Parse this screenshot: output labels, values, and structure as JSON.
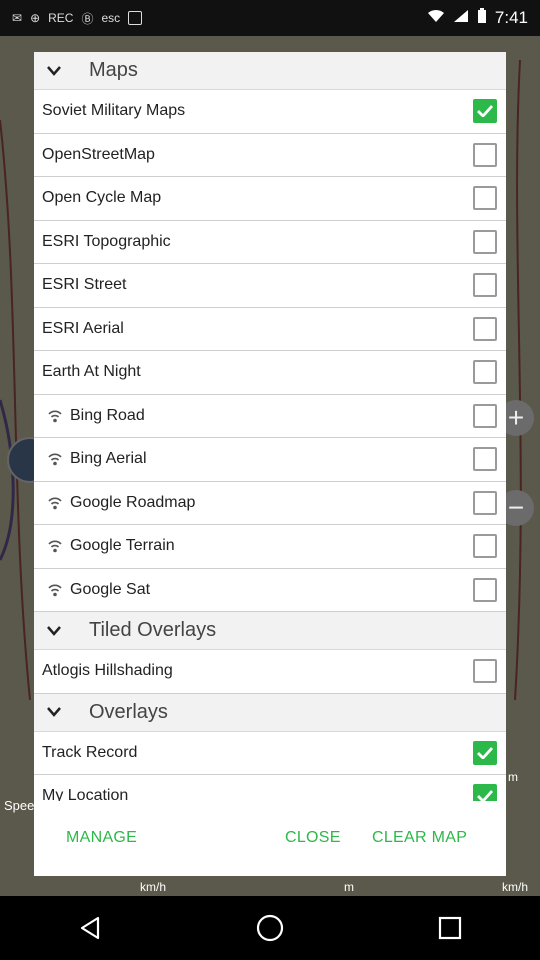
{
  "status_bar": {
    "time": "7:41",
    "icons": [
      "mail-icon",
      "bitcoin-icon",
      "rec-icon",
      "b-icon",
      "esc-icon",
      "box-icon"
    ]
  },
  "dialog": {
    "sections": [
      {
        "title": "Maps",
        "items": [
          {
            "label": "Soviet Military Maps",
            "checked": true,
            "wifi": false
          },
          {
            "label": "OpenStreetMap",
            "checked": false,
            "wifi": false
          },
          {
            "label": "Open Cycle Map",
            "checked": false,
            "wifi": false
          },
          {
            "label": "ESRI Topographic",
            "checked": false,
            "wifi": false
          },
          {
            "label": "ESRI Street",
            "checked": false,
            "wifi": false
          },
          {
            "label": "ESRI Aerial",
            "checked": false,
            "wifi": false
          },
          {
            "label": "Earth At Night",
            "checked": false,
            "wifi": false
          },
          {
            "label": "Bing Road",
            "checked": false,
            "wifi": true
          },
          {
            "label": "Bing Aerial",
            "checked": false,
            "wifi": true
          },
          {
            "label": "Google Roadmap",
            "checked": false,
            "wifi": true
          },
          {
            "label": "Google Terrain",
            "checked": false,
            "wifi": true
          },
          {
            "label": "Google Sat",
            "checked": false,
            "wifi": true
          }
        ]
      },
      {
        "title": "Tiled Overlays",
        "items": [
          {
            "label": "Atlogis Hillshading",
            "checked": false,
            "wifi": false
          }
        ]
      },
      {
        "title": "Overlays",
        "items": [
          {
            "label": "Track Record",
            "checked": true,
            "wifi": false
          },
          {
            "label": "My Location",
            "checked": true,
            "wifi": false
          }
        ]
      }
    ],
    "buttons": {
      "manage": "MANAGE",
      "close": "CLOSE",
      "clear_map": "CLEAR MAP"
    }
  },
  "background": {
    "labels": [
      "km/h",
      "m",
      "km/h",
      "m",
      "Spee"
    ]
  },
  "colors": {
    "accent": "#2db84a",
    "section_bg": "#f2f2f2",
    "divider": "#cfcfcf"
  }
}
